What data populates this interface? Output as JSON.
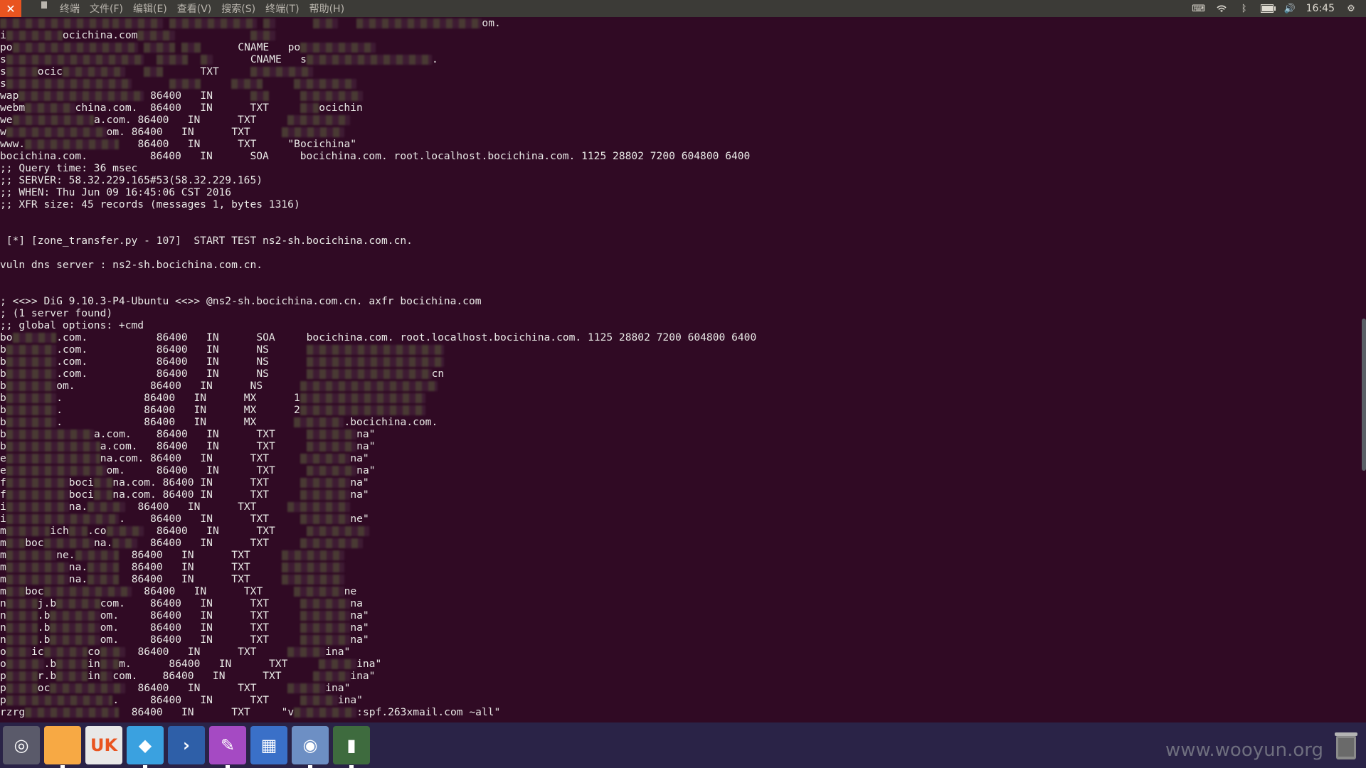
{
  "topbar": {
    "close_symbol": "✕",
    "menu": [
      "终端",
      "文件(F)",
      "编辑(E)",
      "查看(V)",
      "搜索(S)",
      "终端(T)",
      "帮助(H)"
    ],
    "clock": "16:45",
    "battery_fraction": 0.85
  },
  "terminal": {
    "lines": [
      {
        "parts": [
          {
            "b": 18
          },
          {
            "b": 8
          },
          {
            "t": " "
          },
          {
            "b": 14
          },
          {
            "t": " "
          },
          {
            "b": 2
          },
          {
            "t": "      "
          },
          {
            "b": 4
          },
          {
            "t": "   "
          },
          {
            "b": 20
          },
          {
            "t": "om."
          }
        ]
      },
      {
        "parts": [
          {
            "t": "i"
          },
          {
            "b": 9
          },
          {
            "t": "ocichina.com"
          },
          {
            "b": 6
          },
          {
            "t": "            "
          },
          {
            "b": 4
          }
        ]
      },
      {
        "parts": [
          {
            "t": "po"
          },
          {
            "b": 20
          },
          {
            "t": " "
          },
          {
            "b": 5
          },
          {
            "t": " "
          },
          {
            "b": 3
          },
          {
            "t": "      CNAME   po"
          },
          {
            "b": 12
          }
        ]
      },
      {
        "parts": [
          {
            "t": "s"
          },
          {
            "b": 22
          },
          {
            "t": "  "
          },
          {
            "b": 5
          },
          {
            "t": "  "
          },
          {
            "b": 2
          },
          {
            "t": "      CNAME   s"
          },
          {
            "b": 20
          },
          {
            "t": "."
          }
        ]
      },
      {
        "parts": [
          {
            "t": "s"
          },
          {
            "b": 5
          },
          {
            "t": "ocic"
          },
          {
            "b": 10
          },
          {
            "t": "   "
          },
          {
            "b": 3
          },
          {
            "t": "      TXT     "
          },
          {
            "b": 10
          }
        ]
      },
      {
        "parts": [
          {
            "t": "s"
          },
          {
            "b": 20
          },
          {
            "t": "      "
          },
          {
            "b": 5
          },
          {
            "t": "     "
          },
          {
            "b": 5
          },
          {
            "t": "     "
          },
          {
            "b": 10
          }
        ]
      },
      {
        "parts": [
          {
            "t": "wap"
          },
          {
            "b": 20
          },
          {
            "t": " 86400   IN      "
          },
          {
            "b": 3
          },
          {
            "t": "     "
          },
          {
            "b": 10
          }
        ]
      },
      {
        "parts": [
          {
            "t": "webm"
          },
          {
            "b": 8
          },
          {
            "t": "china.com.  86400   IN      TXT     "
          },
          {
            "b": 3
          },
          {
            "t": "ocichin"
          }
        ]
      },
      {
        "parts": [
          {
            "t": "we"
          },
          {
            "b": 13
          },
          {
            "t": "a.com. 86400   IN      TXT     "
          },
          {
            "b": 10
          }
        ]
      },
      {
        "parts": [
          {
            "t": "w"
          },
          {
            "b": 16
          },
          {
            "t": "om. 86400   IN      TXT     "
          },
          {
            "b": 10
          }
        ]
      },
      {
        "parts": [
          {
            "t": "www."
          },
          {
            "b": 15
          },
          {
            "t": "   86400   IN      TXT     \"Bocichina\""
          }
        ]
      },
      {
        "parts": [
          {
            "t": "bocichina.com.          86400   IN      SOA     bocichina.com. root.localhost.bocichina.com. 1125 28802 7200 604800 6400"
          }
        ]
      },
      {
        "parts": [
          {
            "t": ";; Query time: 36 msec"
          }
        ]
      },
      {
        "parts": [
          {
            "t": ";; SERVER: 58.32.229.165#53(58.32.229.165)"
          }
        ]
      },
      {
        "parts": [
          {
            "t": ";; WHEN: Thu Jun 09 16:45:06 CST 2016"
          }
        ]
      },
      {
        "parts": [
          {
            "t": ";; XFR size: 45 records (messages 1, bytes 1316)"
          }
        ]
      },
      {
        "parts": [
          {
            "t": ""
          }
        ]
      },
      {
        "parts": [
          {
            "t": ""
          }
        ]
      },
      {
        "parts": [
          {
            "t": " [*] [zone_transfer.py - 107]  START TEST ns2-sh.bocichina.com.cn."
          }
        ]
      },
      {
        "parts": [
          {
            "t": ""
          }
        ]
      },
      {
        "parts": [
          {
            "t": "vuln dns server : ns2-sh.bocichina.com.cn."
          }
        ]
      },
      {
        "parts": [
          {
            "t": ""
          }
        ]
      },
      {
        "parts": [
          {
            "t": ""
          }
        ]
      },
      {
        "parts": [
          {
            "t": "; <<>> DiG 9.10.3-P4-Ubuntu <<>> @ns2-sh.bocichina.com.cn. axfr bocichina.com"
          }
        ]
      },
      {
        "parts": [
          {
            "t": "; (1 server found)"
          }
        ]
      },
      {
        "parts": [
          {
            "t": ";; global options: +cmd"
          }
        ]
      },
      {
        "parts": [
          {
            "t": "bo"
          },
          {
            "b": 7
          },
          {
            "t": ".com.           86400   IN      SOA     bocichina.com. root.localhost.bocichina.com. 1125 28802 7200 604800 6400"
          }
        ]
      },
      {
        "parts": [
          {
            "t": "b"
          },
          {
            "b": 8
          },
          {
            "t": ".com.           86400   IN      NS      "
          },
          {
            "b": 22
          }
        ]
      },
      {
        "parts": [
          {
            "t": "b"
          },
          {
            "b": 8
          },
          {
            "t": ".com.           86400   IN      NS      "
          },
          {
            "b": 22
          }
        ]
      },
      {
        "parts": [
          {
            "t": "b"
          },
          {
            "b": 8
          },
          {
            "t": ".com.           86400   IN      NS      "
          },
          {
            "b": 20
          },
          {
            "t": "cn"
          }
        ]
      },
      {
        "parts": [
          {
            "t": "b"
          },
          {
            "b": 8
          },
          {
            "t": "om.            86400   IN      NS      "
          },
          {
            "b": 22
          }
        ]
      },
      {
        "parts": [
          {
            "t": "b"
          },
          {
            "b": 8
          },
          {
            "t": ".             86400   IN      MX      1"
          },
          {
            "b": 20
          }
        ]
      },
      {
        "parts": [
          {
            "t": "b"
          },
          {
            "b": 8
          },
          {
            "t": ".             86400   IN      MX      2"
          },
          {
            "b": 20
          }
        ]
      },
      {
        "parts": [
          {
            "t": "b"
          },
          {
            "b": 8
          },
          {
            "t": ".             86400   IN      MX      "
          },
          {
            "b": 8
          },
          {
            "t": ".bocichina.com."
          }
        ]
      },
      {
        "parts": [
          {
            "t": "b"
          },
          {
            "b": 14
          },
          {
            "t": "a.com.    86400   IN      TXT     "
          },
          {
            "b": 8
          },
          {
            "t": "na\""
          }
        ]
      },
      {
        "parts": [
          {
            "t": "b"
          },
          {
            "b": 15
          },
          {
            "t": "a.com.   86400   IN      TXT     "
          },
          {
            "b": 8
          },
          {
            "t": "na\""
          }
        ]
      },
      {
        "parts": [
          {
            "t": "e"
          },
          {
            "b": 15
          },
          {
            "t": "na.com. 86400   IN      TXT     "
          },
          {
            "b": 8
          },
          {
            "t": "na\""
          }
        ]
      },
      {
        "parts": [
          {
            "t": "e"
          },
          {
            "b": 16
          },
          {
            "t": "om.     86400   IN      TXT     "
          },
          {
            "b": 8
          },
          {
            "t": "na\""
          }
        ]
      },
      {
        "parts": [
          {
            "t": "f"
          },
          {
            "b": 10
          },
          {
            "t": "boci"
          },
          {
            "b": 3
          },
          {
            "t": "na.com. 86400 IN      TXT     "
          },
          {
            "b": 8
          },
          {
            "t": "na\""
          }
        ]
      },
      {
        "parts": [
          {
            "t": "f"
          },
          {
            "b": 10
          },
          {
            "t": "boci"
          },
          {
            "b": 3
          },
          {
            "t": "na.com. 86400 IN      TXT     "
          },
          {
            "b": 8
          },
          {
            "t": "na\""
          }
        ]
      },
      {
        "parts": [
          {
            "t": "i"
          },
          {
            "b": 10
          },
          {
            "t": "na."
          },
          {
            "b": 6
          },
          {
            "t": "  86400   IN      TXT     "
          },
          {
            "b": 10
          }
        ]
      },
      {
        "parts": [
          {
            "t": "i"
          },
          {
            "b": 18
          },
          {
            "t": ".    86400   IN      TXT     "
          },
          {
            "b": 8
          },
          {
            "t": "ne\""
          }
        ]
      },
      {
        "parts": [
          {
            "t": "m"
          },
          {
            "b": 7
          },
          {
            "t": "ich"
          },
          {
            "b": 3
          },
          {
            "t": ".co"
          },
          {
            "b": 6
          },
          {
            "t": "  86400   IN      TXT     "
          },
          {
            "b": 10
          }
        ]
      },
      {
        "parts": [
          {
            "t": "m"
          },
          {
            "b": 3
          },
          {
            "t": "boc"
          },
          {
            "b": 8
          },
          {
            "t": "na."
          },
          {
            "b": 4
          },
          {
            "t": "  86400   IN      TXT     "
          },
          {
            "b": 10
          }
        ]
      },
      {
        "parts": [
          {
            "t": "m"
          },
          {
            "b": 8
          },
          {
            "t": "ne."
          },
          {
            "b": 7
          },
          {
            "t": "  86400   IN      TXT     "
          },
          {
            "b": 10
          }
        ]
      },
      {
        "parts": [
          {
            "t": "m"
          },
          {
            "b": 10
          },
          {
            "t": "na."
          },
          {
            "b": 5
          },
          {
            "t": "  86400   IN      TXT     "
          },
          {
            "b": 10
          }
        ]
      },
      {
        "parts": [
          {
            "t": "m"
          },
          {
            "b": 10
          },
          {
            "t": "na."
          },
          {
            "b": 5
          },
          {
            "t": "  86400   IN      TXT     "
          },
          {
            "b": 10
          }
        ]
      },
      {
        "parts": [
          {
            "t": "m"
          },
          {
            "b": 3
          },
          {
            "t": "boc"
          },
          {
            "b": 14
          },
          {
            "t": "  86400   IN      TXT     "
          },
          {
            "b": 8
          },
          {
            "t": "ne"
          }
        ]
      },
      {
        "parts": [
          {
            "t": "n"
          },
          {
            "b": 5
          },
          {
            "t": "j.b"
          },
          {
            "b": 7
          },
          {
            "t": "com.    86400   IN      TXT     "
          },
          {
            "b": 8
          },
          {
            "t": "na"
          }
        ]
      },
      {
        "parts": [
          {
            "t": "n"
          },
          {
            "b": 5
          },
          {
            "t": ".b"
          },
          {
            "b": 8
          },
          {
            "t": "om.     86400   IN      TXT     "
          },
          {
            "b": 8
          },
          {
            "t": "na\""
          }
        ]
      },
      {
        "parts": [
          {
            "t": "n"
          },
          {
            "b": 5
          },
          {
            "t": ".b"
          },
          {
            "b": 8
          },
          {
            "t": "om.     86400   IN      TXT     "
          },
          {
            "b": 8
          },
          {
            "t": "na\""
          }
        ]
      },
      {
        "parts": [
          {
            "t": "n"
          },
          {
            "b": 5
          },
          {
            "t": ".b"
          },
          {
            "b": 8
          },
          {
            "t": "om.     86400   IN      TXT     "
          },
          {
            "b": 8
          },
          {
            "t": "na\""
          }
        ]
      },
      {
        "parts": [
          {
            "t": "o"
          },
          {
            "b": 4
          },
          {
            "t": "ic"
          },
          {
            "b": 7
          },
          {
            "t": "co"
          },
          {
            "b": 4
          },
          {
            "t": "  86400   IN      TXT     "
          },
          {
            "b": 6
          },
          {
            "t": "ina\""
          }
        ]
      },
      {
        "parts": [
          {
            "t": "o"
          },
          {
            "b": 6
          },
          {
            "t": ".b"
          },
          {
            "b": 5
          },
          {
            "t": "in"
          },
          {
            "b": 3
          },
          {
            "t": "m.      86400   IN      TXT     "
          },
          {
            "b": 6
          },
          {
            "t": "ina\""
          }
        ]
      },
      {
        "parts": [
          {
            "t": "p"
          },
          {
            "b": 5
          },
          {
            "t": "r.b"
          },
          {
            "b": 5
          },
          {
            "t": "in"
          },
          {
            "b": 2
          },
          {
            "t": "com.    86400   IN      TXT     "
          },
          {
            "b": 6
          },
          {
            "t": "ina\""
          }
        ]
      },
      {
        "parts": [
          {
            "t": "p"
          },
          {
            "b": 5
          },
          {
            "t": "oc"
          },
          {
            "b": 12
          },
          {
            "t": "  86400   IN      TXT     "
          },
          {
            "b": 6
          },
          {
            "t": "ina\""
          }
        ]
      },
      {
        "parts": [
          {
            "t": "p"
          },
          {
            "b": 17
          },
          {
            "t": ".     86400   IN      TXT     "
          },
          {
            "b": 6
          },
          {
            "t": "ina\""
          }
        ]
      },
      {
        "parts": [
          {
            "t": "rzrg"
          },
          {
            "b": 15
          },
          {
            "t": "  86400   IN      TXT     \"v"
          },
          {
            "b": 10
          },
          {
            "t": ":spf.263xmail.com ~all\""
          }
        ]
      }
    ]
  },
  "dock": {
    "items": [
      {
        "name": "dash-button",
        "symbol": "◎",
        "bg": "#5a5a6a",
        "color": "#ffffff",
        "active": false
      },
      {
        "name": "files-app",
        "symbol": "",
        "bg": "#f7a944",
        "color": "#ffffff",
        "active": true
      },
      {
        "name": "ubuntu-software-app",
        "symbol": "UK",
        "bg": "#e8e8e8",
        "color": "#e95420",
        "active": false
      },
      {
        "name": "app-launcher-blue",
        "symbol": "◆",
        "bg": "#3aa1e0",
        "color": "#ffffff",
        "active": true
      },
      {
        "name": "code-editor-app",
        "symbol": "›",
        "bg": "#2e5fa8",
        "color": "#ffffff",
        "active": false
      },
      {
        "name": "text-editor-app",
        "symbol": "✎",
        "bg": "#a54ac3",
        "color": "#ffffff",
        "active": true
      },
      {
        "name": "window-manager-app",
        "symbol": "▦",
        "bg": "#3a70c8",
        "color": "#ffffff",
        "active": false
      },
      {
        "name": "browser-app",
        "symbol": "◉",
        "bg": "#6d8fc4",
        "color": "#ffffff",
        "active": true
      },
      {
        "name": "terminal-app",
        "symbol": "▮",
        "bg": "#3e6b3e",
        "color": "#ffffff",
        "active": true
      }
    ]
  },
  "watermark": "www.wooyun.org"
}
